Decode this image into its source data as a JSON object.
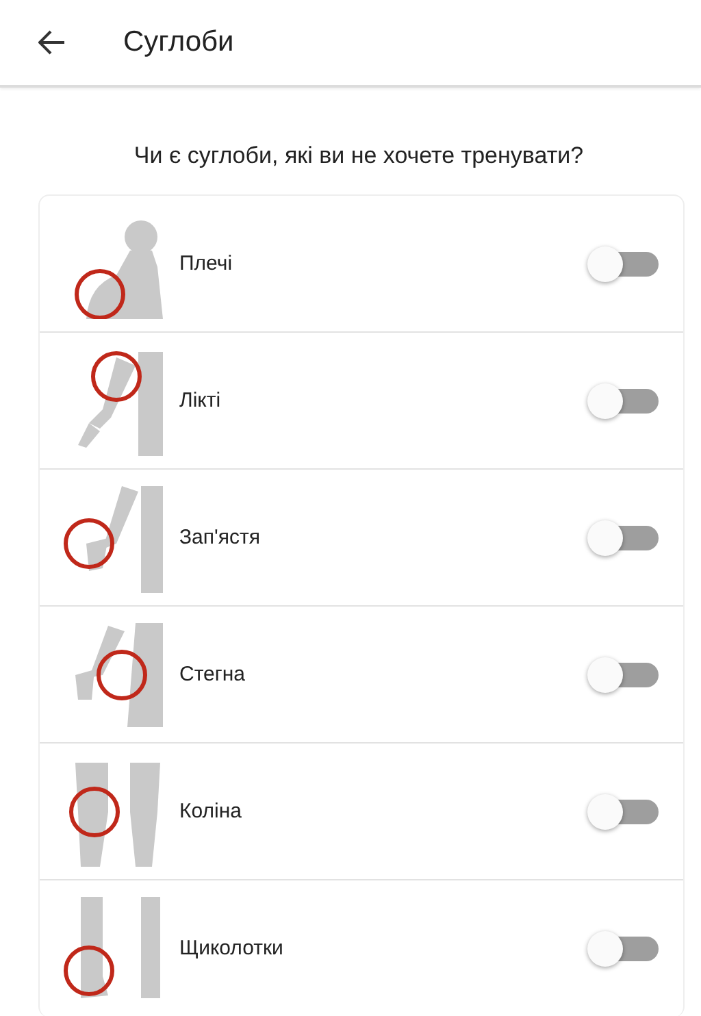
{
  "header": {
    "title": "Суглоби"
  },
  "question": "Чи є суглоби, які ви не хочете тренувати?",
  "joints": [
    {
      "kind": "shoulder",
      "label": "Плечі",
      "on": false
    },
    {
      "kind": "elbow",
      "label": "Лікті",
      "on": false
    },
    {
      "kind": "wrist",
      "label": "Зап'ястя",
      "on": false
    },
    {
      "kind": "hip",
      "label": "Стегна",
      "on": false
    },
    {
      "kind": "knee",
      "label": "Коліна",
      "on": false
    },
    {
      "kind": "ankle",
      "label": "Щиколотки",
      "on": false
    }
  ]
}
